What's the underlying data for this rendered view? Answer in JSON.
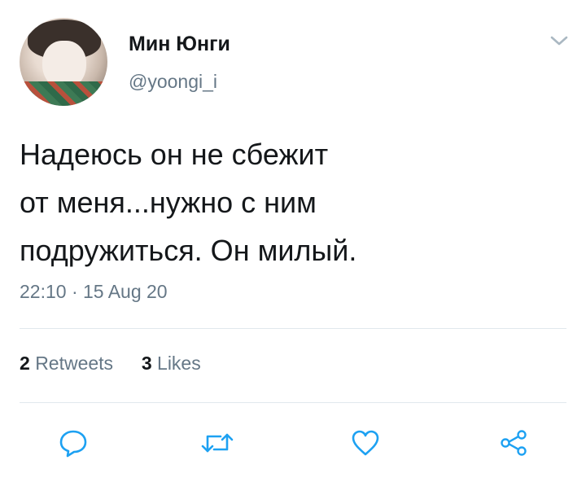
{
  "user": {
    "display_name": "Мин Юнги",
    "handle": "@yoongi_i"
  },
  "tweet": {
    "text_lines": [
      "Надеюсь он не сбежит",
      "от меня...нужно с ним",
      "подружиться. Он милый."
    ],
    "timestamp": "22:10 · 15 Aug 20"
  },
  "stats": {
    "retweets_count": "2",
    "retweets_label": "Retweets",
    "likes_count": "3",
    "likes_label": "Likes"
  },
  "icons": {
    "menu": "chevron-down-icon",
    "reply": "reply-icon",
    "retweet": "retweet-icon",
    "like": "heart-icon",
    "share": "share-icon"
  },
  "colors": {
    "text": "#14171a",
    "secondary": "#657786",
    "icon": "#1da1f2",
    "divider": "#e1e8ed"
  }
}
